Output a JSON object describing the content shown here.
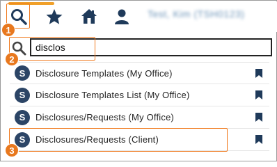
{
  "toolbar": {
    "search_icon": "search-icon",
    "favorites_icon": "star-icon",
    "home_icon": "home-icon",
    "user_icon": "person-icon",
    "client_name": "Test, Kim (TSH0123)"
  },
  "search": {
    "query": "disclos",
    "icon": "search-icon"
  },
  "results": [
    {
      "badge": "S",
      "label": "Disclosure Templates (My Office)",
      "icon": "bookmark-icon"
    },
    {
      "badge": "S",
      "label": "Disclosure Templates List (My Office)",
      "icon": "bookmark-icon"
    },
    {
      "badge": "S",
      "label": "Disclosures/Requests (My Office)",
      "icon": "bookmark-icon"
    },
    {
      "badge": "S",
      "label": "Disclosures/Requests (Client)",
      "icon": "bookmark-icon"
    }
  ],
  "callouts": [
    "1",
    "2",
    "3"
  ],
  "colors": {
    "accent_orange": "#e8781e",
    "badge_navy": "#2c4566",
    "active_tab": "#f0a02a"
  }
}
